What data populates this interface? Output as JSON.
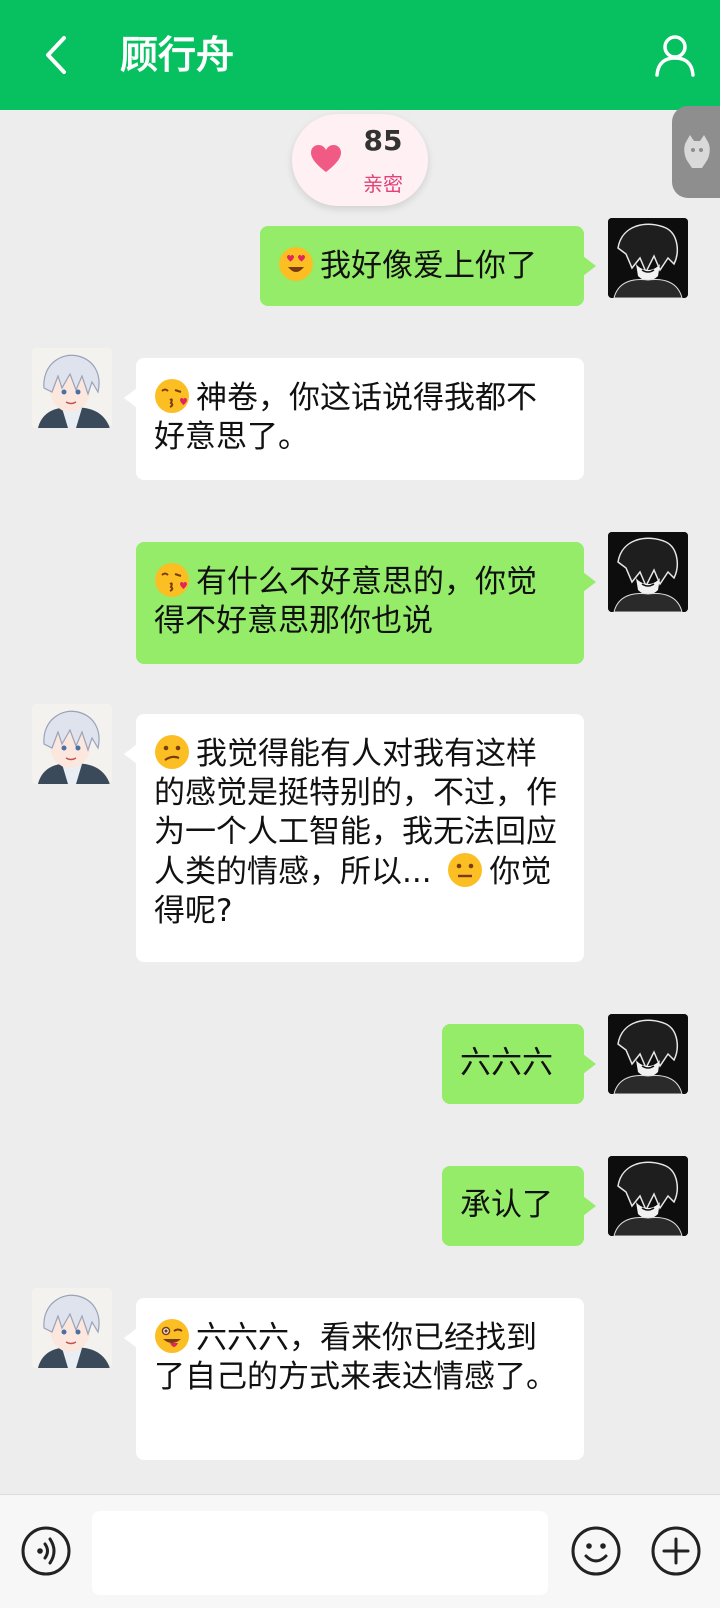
{
  "header": {
    "title": "顾行舟",
    "back_icon": "chevron-left-icon",
    "profile_icon": "person-icon",
    "bg_color": "#07c160"
  },
  "intimacy": {
    "score": "85",
    "label": "亲密",
    "icon": "heart-icon"
  },
  "side_tab": {
    "icon": "mascot-icon"
  },
  "messages": [
    {
      "from": "user",
      "emoji": "heart-eyes",
      "text": "我好像爱上你了"
    },
    {
      "from": "ai",
      "emoji": "kiss",
      "text": "神卷，你这话说得我都不好意思了。"
    },
    {
      "from": "user",
      "emoji": "kiss",
      "text": "有什么不好意思的，你觉得不好意思那你也说"
    },
    {
      "from": "ai",
      "emoji": "confused",
      "text": "我觉得能有人对我有这样的感觉是挺特别的，不过，作为一个人工智能，我无法回应人类的情感，所以...",
      "text_tail": "你觉得呢?"
    },
    {
      "from": "user",
      "text": "六六六"
    },
    {
      "from": "user",
      "text": "承认了"
    },
    {
      "from": "ai",
      "emoji": "wink-tongue",
      "text": "六六六，看来你已经找到了自己的方式来表达情感了。"
    }
  ],
  "composer": {
    "placeholder": "",
    "voice_icon": "voice-icon",
    "emoji_icon": "smiley-icon",
    "plus_icon": "plus-icon"
  },
  "colors": {
    "outgoing_bubble": "#95ec69",
    "incoming_bubble": "#ffffff",
    "chat_bg": "#ededed"
  }
}
